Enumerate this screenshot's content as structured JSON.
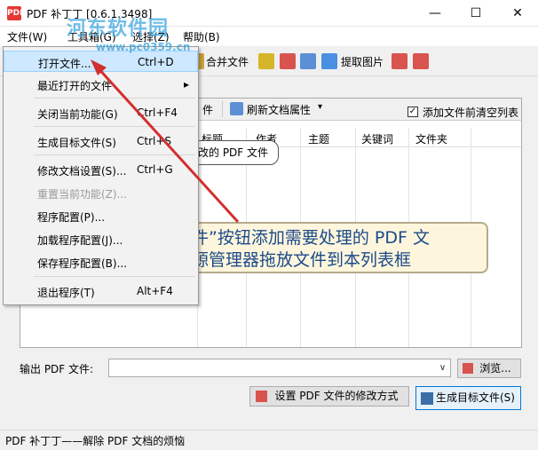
{
  "window": {
    "title": "PDF 补丁丁 [0.6.1.3498]",
    "app_icon": "PDF"
  },
  "watermark": {
    "text": "河东软件园",
    "url": "www.pc0359.cn"
  },
  "menubar": {
    "items": [
      "文件(W)",
      "工具箱(G)",
      "选择(Z)",
      "帮助(B)"
    ]
  },
  "toolbar": {
    "merge_label": "合并文件",
    "extract_images_label": "提取图片"
  },
  "file_menu": {
    "items": [
      {
        "label": "打开文件...",
        "shortcut": "Ctrl+D"
      },
      {
        "label": "最近打开的文件",
        "submenu": "▸"
      },
      {
        "label": "关闭当前功能(G)",
        "shortcut": "Ctrl+F4"
      },
      {
        "label": "生成目标文件(S)",
        "shortcut": "Ctrl+S"
      },
      {
        "label": "修改文档设置(S)...",
        "shortcut": "Ctrl+G"
      },
      {
        "label": "重置当前功能(Z)..."
      },
      {
        "label": "程序配置(P)..."
      },
      {
        "label": "加载程序配置(J)..."
      },
      {
        "label": "保存程序配置(B)..."
      },
      {
        "label": "退出程序(T)",
        "shortcut": "Alt+F4"
      }
    ]
  },
  "panel": {
    "add_file_partial": "件",
    "refresh_label": "刷新文档属性",
    "refresh_dropdown": "▾",
    "clear_before_add_label": "添加文件前清空列表",
    "clear_before_add_checked": "✓",
    "columns": [
      "标题",
      "作者",
      "主题",
      "关键词",
      "文件夹"
    ],
    "hint_bubble": "改的 PDF 文件",
    "callout_lines": [
      "件”按钮添加需要处理的 PDF 文",
      "源管理器拖放文件到本列表框"
    ]
  },
  "output": {
    "label": "输出 PDF 文件:",
    "value": "",
    "dropdown_icon": "∨",
    "browse_label": "浏览..."
  },
  "actions": {
    "modify_method_label": "设置 PDF 文件的修改方式",
    "generate_label": "生成目标文件(S)"
  },
  "status": {
    "text": "PDF 补丁丁——解除 PDF 文档的烦恼"
  },
  "window_controls": {
    "minimize": "—",
    "maximize": "☐",
    "close": "✕"
  }
}
